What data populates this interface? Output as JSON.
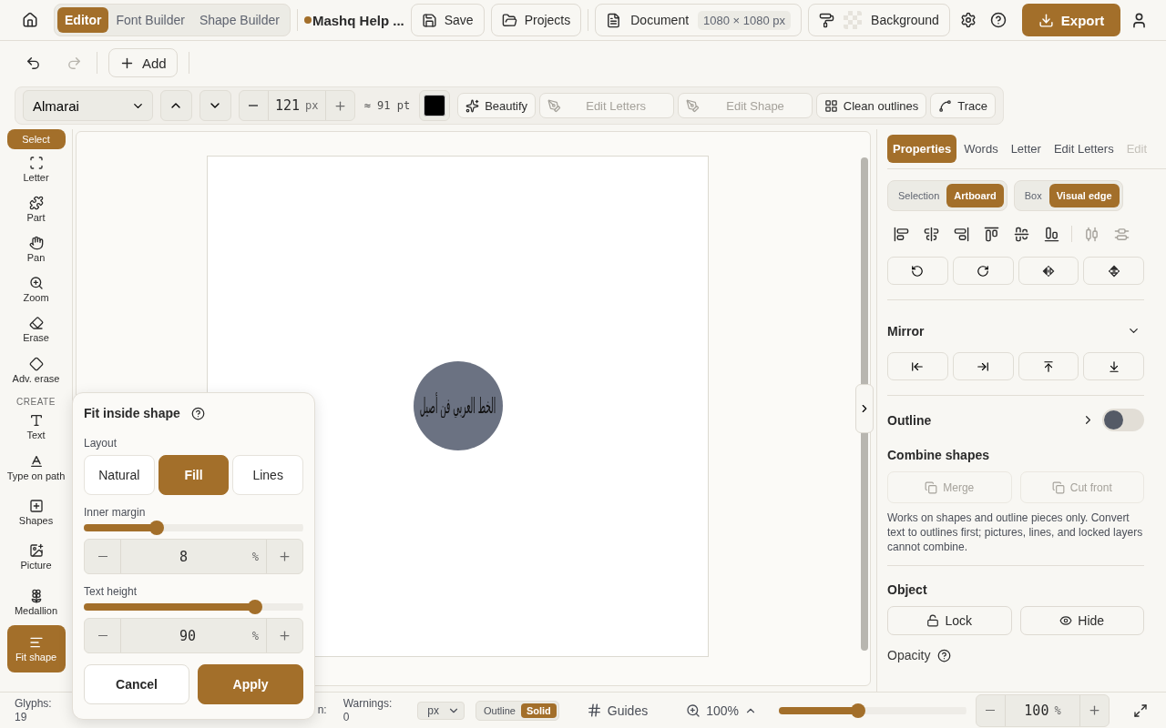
{
  "top_bar": {
    "modes": [
      {
        "label": "Editor",
        "selected": true
      },
      {
        "label": "Font Builder",
        "selected": false
      },
      {
        "label": "Shape Builder",
        "selected": false
      }
    ],
    "project_title": "Mashq Help ...",
    "unsaved": true,
    "buttons": [
      {
        "label": "Save"
      },
      {
        "label": "Projects"
      }
    ],
    "document": {
      "label": "Document",
      "size": "1080 × 1080 px"
    },
    "background": {
      "label": "Background"
    },
    "export": "Export"
  },
  "edit_bar": {
    "undo_disabled": false,
    "redo_disabled": true,
    "add": "Add"
  },
  "toolbar": {
    "font": "Almarai",
    "size": "121",
    "size_unit": "px",
    "points": "≈ 91 pt",
    "color": "#000000",
    "actions": [
      {
        "label": "Beautify",
        "disabled": false
      },
      {
        "label": "Edit Letters",
        "disabled": true
      },
      {
        "label": "Edit Shape",
        "disabled": true
      },
      {
        "label": "Clean outlines",
        "disabled": false
      },
      {
        "label": "Trace",
        "disabled": false
      }
    ]
  },
  "tool_groups": [
    {
      "tools": [
        {
          "label": "Select",
          "selected": true
        },
        {
          "label": "Letter",
          "selected": false
        },
        {
          "label": "Part",
          "selected": false
        },
        {
          "label": "Pan",
          "selected": false
        },
        {
          "label": "Zoom",
          "selected": false
        },
        {
          "label": "Erase",
          "selected": false
        },
        {
          "label": "Adv. erase",
          "selected": false
        }
      ]
    },
    {
      "heading": "CREATE",
      "tools": [
        {
          "label": "Text",
          "selected": false
        },
        {
          "label": "Type on path",
          "selected": false
        },
        {
          "label": "Shapes",
          "selected": false
        },
        {
          "label": "Picture",
          "selected": false
        },
        {
          "label": "Medallion",
          "selected": false
        },
        {
          "label": "Fit shape",
          "selected": true
        }
      ]
    }
  ],
  "canvas": {
    "artwork_text": "الخط العربي فن أصيل"
  },
  "panel": {
    "tabs": [
      {
        "label": "Properties",
        "selected": true,
        "disabled": false
      },
      {
        "label": "Words",
        "selected": false,
        "disabled": false
      },
      {
        "label": "Letter",
        "selected": false,
        "disabled": false
      },
      {
        "label": "Edit Letters",
        "selected": false,
        "disabled": false
      },
      {
        "label": "Edit",
        "selected": false,
        "disabled": true
      }
    ],
    "segments": [
      [
        {
          "label": "Selection",
          "selected": false
        },
        {
          "label": "Artboard",
          "selected": true
        }
      ],
      [
        {
          "label": "Box",
          "selected": false
        },
        {
          "label": "Visual edge",
          "selected": true
        }
      ]
    ],
    "mirror": {
      "title": "Mirror",
      "expanded": true
    },
    "outline": {
      "title": "Outline",
      "on": false
    },
    "combine": {
      "title": "Combine shapes",
      "buttons": [
        {
          "label": "Merge",
          "disabled": true
        },
        {
          "label": "Cut front",
          "disabled": true
        }
      ],
      "note": "Works on shapes and outline pieces only. Convert text to outlines first; pictures, lines, and locked layers cannot combine."
    },
    "object": {
      "title": "Object",
      "buttons": [
        {
          "label": "Lock"
        },
        {
          "label": "Hide"
        }
      ]
    },
    "opacity": {
      "title": "Opacity"
    }
  },
  "status": {
    "items": [
      {
        "label": "Glyphs:",
        "value": "19"
      },
      {
        "label": "n:"
      },
      {
        "label": "Warnings:",
        "value": "0"
      }
    ],
    "unit": "px",
    "render_modes": [
      {
        "label": "Outline",
        "selected": false
      },
      {
        "label": "Solid",
        "selected": true
      }
    ],
    "guides": "Guides",
    "zoom": "100%",
    "zoom_slider": {
      "level": 0.42
    },
    "zoom_value": "100",
    "zoom_unit": "%"
  },
  "popover": {
    "title": "Fit inside shape",
    "layout_label": "Layout",
    "layouts": [
      {
        "label": "Natural",
        "selected": false
      },
      {
        "label": "Fill",
        "selected": true
      },
      {
        "label": "Lines",
        "selected": false
      }
    ],
    "sliders": [
      {
        "label": "Inner margin",
        "level": 0.33,
        "value": "8",
        "unit": "%"
      },
      {
        "label": "Text height",
        "level": 0.78,
        "value": "90",
        "unit": "%"
      }
    ],
    "cancel": "Cancel",
    "apply": "Apply"
  }
}
